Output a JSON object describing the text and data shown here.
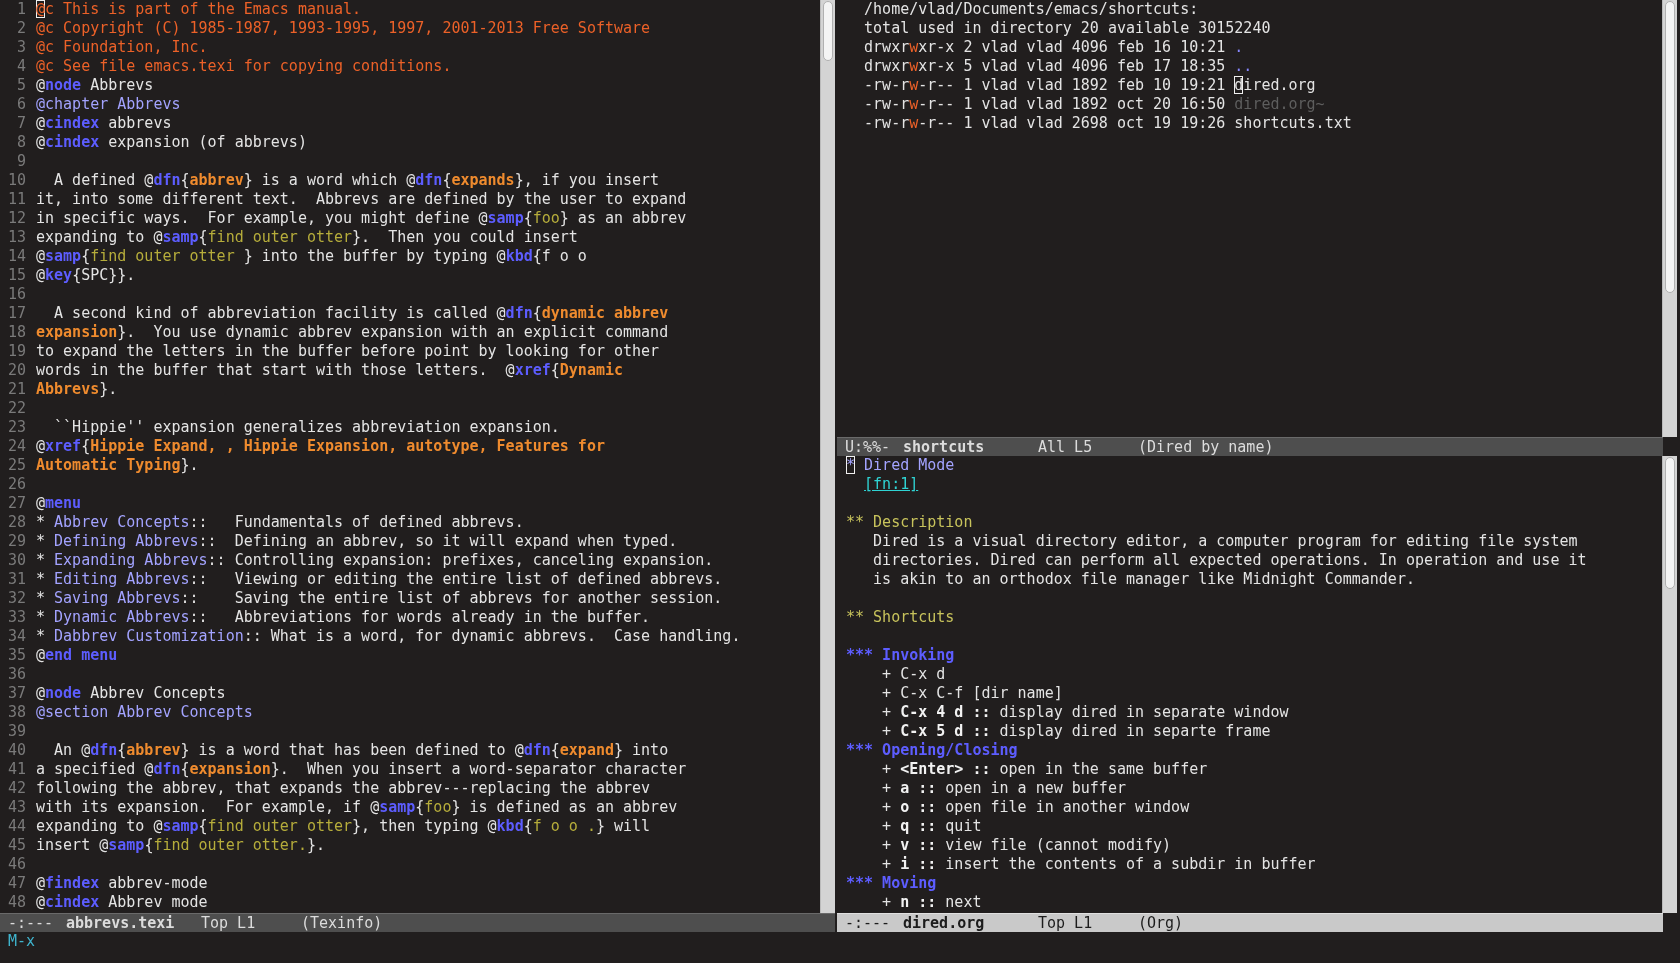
{
  "left_pane": {
    "lines": [
      {
        "number": "1",
        "segments": [
          {
            "text": "@",
            "kind": "comment",
            "cursor": true
          },
          {
            "text": "c This is part of the Emacs manual.",
            "kind": "comment"
          }
        ]
      },
      {
        "number": "2",
        "segments": [
          {
            "text": "@c Copyright (C) 1985-1987, 1993-1995, 1997, 2001-2013 Free Software",
            "kind": "comment"
          }
        ]
      },
      {
        "number": "3",
        "segments": [
          {
            "text": "@c Foundation, Inc.",
            "kind": "comment"
          }
        ]
      },
      {
        "number": "4",
        "segments": [
          {
            "text": "@c See file emacs.texi for copying conditions.",
            "kind": "comment"
          }
        ]
      },
      {
        "number": "5",
        "segments": [
          "@",
          {
            "text": "node",
            "kind": "command"
          },
          " Abbrevs"
        ]
      },
      {
        "number": "6",
        "segments": [
          {
            "text": "@chapter Abbrevs",
            "kind": "title"
          }
        ]
      },
      {
        "number": "7",
        "segments": [
          "@",
          {
            "text": "cindex",
            "kind": "command"
          },
          " abbrevs"
        ]
      },
      {
        "number": "8",
        "segments": [
          "@",
          {
            "text": "cindex",
            "kind": "command"
          },
          " expansion (of abbrevs)"
        ]
      },
      {
        "number": "9"
      },
      {
        "number": "10",
        "segments": [
          "  A defined @",
          {
            "text": "dfn",
            "kind": "command"
          },
          "{",
          {
            "text": "abbrev",
            "kind": "argument"
          },
          "} is a word which @",
          {
            "text": "dfn",
            "kind": "command"
          },
          "{",
          {
            "text": "expands",
            "kind": "argument"
          },
          "}, if you insert"
        ]
      },
      {
        "number": "11",
        "segments": [
          "it, into some different text.  Abbrevs are defined by the user to expand"
        ]
      },
      {
        "number": "12",
        "segments": [
          "in specific ways.  For example, you might define @",
          {
            "text": "samp",
            "kind": "command"
          },
          "{",
          {
            "text": "foo",
            "kind": "sample"
          },
          "} as an abbrev"
        ]
      },
      {
        "number": "13",
        "segments": [
          "expanding to @",
          {
            "text": "samp",
            "kind": "command"
          },
          "{",
          {
            "text": "find outer otter",
            "kind": "sample"
          },
          "}.  Then you could insert"
        ]
      },
      {
        "number": "14",
        "segments": [
          "@",
          {
            "text": "samp",
            "kind": "command"
          },
          "{",
          {
            "text": "find outer otter ",
            "kind": "sample"
          },
          "} into the buffer by typing @",
          {
            "text": "kbd",
            "kind": "command"
          },
          "{f o o"
        ]
      },
      {
        "number": "15",
        "segments": [
          "@",
          {
            "text": "key",
            "kind": "command"
          },
          "{SPC}}."
        ]
      },
      {
        "number": "16"
      },
      {
        "number": "17",
        "segments": [
          "  A second kind of abbreviation facility is called @",
          {
            "text": "dfn",
            "kind": "command"
          },
          "{",
          {
            "text": "dynamic abbrev",
            "kind": "argument"
          }
        ]
      },
      {
        "number": "18",
        "segments": [
          {
            "text": "expansion",
            "kind": "argument"
          },
          "}.  You use dynamic abbrev expansion with an explicit command"
        ]
      },
      {
        "number": "19",
        "segments": [
          "to expand the letters in the buffer before point by looking for other"
        ]
      },
      {
        "number": "20",
        "segments": [
          "words in the buffer that start with those letters.  @",
          {
            "text": "xref",
            "kind": "command"
          },
          "{",
          {
            "text": "Dynamic",
            "kind": "argument"
          }
        ]
      },
      {
        "number": "21",
        "segments": [
          {
            "text": "Abbrevs",
            "kind": "argument"
          },
          "}."
        ]
      },
      {
        "number": "22"
      },
      {
        "number": "23",
        "segments": [
          "  ``Hippie'' expansion generalizes abbreviation expansion."
        ]
      },
      {
        "number": "24",
        "segments": [
          "@",
          {
            "text": "xref",
            "kind": "command"
          },
          "{",
          {
            "text": "Hippie Expand, , Hippie Expansion, autotype, Features for",
            "kind": "argument"
          }
        ]
      },
      {
        "number": "25",
        "segments": [
          {
            "text": "Automatic Typing",
            "kind": "argument"
          },
          "}."
        ]
      },
      {
        "number": "26"
      },
      {
        "number": "27",
        "segments": [
          "@",
          {
            "text": "menu",
            "kind": "command"
          }
        ]
      },
      {
        "number": "28",
        "segments": [
          "* ",
          {
            "text": "Abbrev Concepts",
            "kind": "title"
          },
          "::   Fundamentals of defined abbrevs."
        ]
      },
      {
        "number": "29",
        "segments": [
          "* ",
          {
            "text": "Defining Abbrevs",
            "kind": "title"
          },
          "::  Defining an abbrev, so it will expand when typed."
        ]
      },
      {
        "number": "30",
        "segments": [
          "* ",
          {
            "text": "Expanding Abbrevs",
            "kind": "title"
          },
          ":: Controlling expansion: prefixes, canceling expansion."
        ]
      },
      {
        "number": "31",
        "segments": [
          "* ",
          {
            "text": "Editing Abbrevs",
            "kind": "title"
          },
          "::   Viewing or editing the entire list of defined abbrevs."
        ]
      },
      {
        "number": "32",
        "segments": [
          "* ",
          {
            "text": "Saving Abbrevs",
            "kind": "title"
          },
          "::    Saving the entire list of abbrevs for another session."
        ]
      },
      {
        "number": "33",
        "segments": [
          "* ",
          {
            "text": "Dynamic Abbrevs",
            "kind": "title"
          },
          "::   Abbreviations for words already in the buffer."
        ]
      },
      {
        "number": "34",
        "segments": [
          "* ",
          {
            "text": "Dabbrev Customization",
            "kind": "title"
          },
          ":: What is a word, for dynamic abbrevs.  Case handling."
        ]
      },
      {
        "number": "35",
        "segments": [
          "@",
          {
            "text": "end menu",
            "kind": "command"
          }
        ]
      },
      {
        "number": "36"
      },
      {
        "number": "37",
        "segments": [
          "@",
          {
            "text": "node",
            "kind": "command"
          },
          " Abbrev Concepts"
        ]
      },
      {
        "number": "38",
        "segments": [
          {
            "text": "@section Abbrev Concepts",
            "kind": "title"
          }
        ]
      },
      {
        "number": "39"
      },
      {
        "number": "40",
        "segments": [
          "  An @",
          {
            "text": "dfn",
            "kind": "command"
          },
          "{",
          {
            "text": "abbrev",
            "kind": "argument"
          },
          "} is a word that has been defined to @",
          {
            "text": "dfn",
            "kind": "command"
          },
          "{",
          {
            "text": "expand",
            "kind": "argument"
          },
          "} into"
        ]
      },
      {
        "number": "41",
        "segments": [
          "a specified @",
          {
            "text": "dfn",
            "kind": "command"
          },
          "{",
          {
            "text": "expansion",
            "kind": "argument"
          },
          "}.  When you insert a word-separator character"
        ]
      },
      {
        "number": "42",
        "segments": [
          "following the abbrev, that expands the abbrev---replacing the abbrev"
        ]
      },
      {
        "number": "43",
        "segments": [
          "with its expansion.  For example, if @",
          {
            "text": "samp",
            "kind": "command"
          },
          "{",
          {
            "text": "foo",
            "kind": "sample"
          },
          "} is defined as an abbrev"
        ]
      },
      {
        "number": "44",
        "segments": [
          "expanding to @",
          {
            "text": "samp",
            "kind": "command"
          },
          "{",
          {
            "text": "find outer otter",
            "kind": "sample"
          },
          "}, then typing @",
          {
            "text": "kbd",
            "kind": "command"
          },
          "{",
          {
            "text": "f o o .",
            "kind": "sample"
          },
          "} will"
        ]
      },
      {
        "number": "45",
        "segments": [
          "insert @",
          {
            "text": "samp",
            "kind": "command"
          },
          "{",
          {
            "text": "find outer otter.",
            "kind": "sample"
          },
          "}."
        ]
      },
      {
        "number": "46"
      },
      {
        "number": "47",
        "segments": [
          "@",
          {
            "text": "findex",
            "kind": "command"
          },
          " abbrev-mode"
        ]
      },
      {
        "number": "48",
        "segments": [
          "@",
          {
            "text": "cindex",
            "kind": "command"
          },
          " Abbrev mode"
        ]
      }
    ],
    "mode_line": {
      "status": "-:---",
      "buffer": "abbrevs.texi",
      "position": "Top L1",
      "mode": "(Texinfo)",
      "active": false
    }
  },
  "right_top_pane": {
    "lines": [
      {
        "segments": [
          "  /home/vlad/Documents/emacs/shortcuts:"
        ]
      },
      {
        "segments": [
          "  total used in directory 20 available 30152240"
        ]
      },
      {
        "segments": [
          "  drwxr",
          {
            "text": "w",
            "kind": "write_flag"
          },
          "xr-x 2 vlad vlad 4096 feb 16 10:21 ",
          {
            "text": ".",
            "kind": "directory"
          }
        ]
      },
      {
        "segments": [
          "  drwxr",
          {
            "text": "w",
            "kind": "write_flag"
          },
          "xr-x 5 vlad vlad 4096 feb 17 18:35 ",
          {
            "text": "..",
            "kind": "directory"
          }
        ]
      },
      {
        "segments": [
          "  -rw-r",
          {
            "text": "w",
            "kind": "write_flag"
          },
          "-r-- 1 vlad vlad 1892 feb 10 19:21 ",
          {
            "text": "d",
            "kind": "plain",
            "cursor": true
          },
          "ired.org"
        ]
      },
      {
        "segments": [
          "  -rw-r",
          {
            "text": "w",
            "kind": "write_flag"
          },
          "-r-- 1 vlad vlad 1892 oct 20 16:50 ",
          {
            "text": "dired.org~",
            "kind": "backup"
          }
        ]
      },
      {
        "segments": [
          "  -rw-r",
          {
            "text": "w",
            "kind": "write_flag"
          },
          "-r-- 1 vlad vlad 2698 oct 19 19:26 shortcuts.txt"
        ]
      }
    ],
    "mode_line": {
      "status": "U:%%-",
      "buffer": "shortcuts",
      "position": "All L5",
      "mode": "(Dired by name)",
      "active": false
    }
  },
  "right_bottom_pane": {
    "blocks": [
      {
        "lines": [
          {
            "segments": [
              {
                "text": "*",
                "kind": "heading_1",
                "cursor": true
              },
              {
                "text": " Dired Mode",
                "kind": "heading_1"
              }
            ]
          },
          {
            "segments": [
              {
                "text": "[fn:1]",
                "kind": "link"
              }
            ]
          }
        ]
      },
      {
        "lines": [
          {
            "segments": [
              {
                "text": "** Description",
                "kind": "heading_2"
              }
            ]
          },
          {
            "segments": [
              "   Dired is a visual directory editor, a computer program for editing file system"
            ]
          },
          {
            "segments": [
              "   directories. Dired can perform all expected operations. In operation and use it"
            ]
          },
          {
            "segments": [
              "   is akin to an orthodox file manager like Midnight Commander."
            ]
          }
        ]
      },
      {
        "lines": [
          {
            "segments": [
              {
                "text": "** Shortcuts",
                "kind": "heading_2"
              }
            ]
          }
        ]
      },
      {
        "lines": [
          {
            "segments": [
              {
                "text": "*** Invoking",
                "kind": "heading_3"
              }
            ]
          },
          {
            "segments": [
              "    + C-x d"
            ]
          },
          {
            "segments": [
              "    + C-x C-f [dir name]"
            ]
          },
          {
            "segments": [
              "    + ",
              {
                "text": "C-x 4 d ::",
                "kind": "bold"
              },
              " display dired in separate window"
            ]
          },
          {
            "segments": [
              "    + ",
              {
                "text": "C-x 5 d ::",
                "kind": "bold"
              },
              " display dired in separte frame"
            ]
          },
          {
            "segments": [
              {
                "text": "*** Opening/Closing",
                "kind": "heading_3"
              }
            ]
          },
          {
            "segments": [
              "    + ",
              {
                "text": "<Enter> ::",
                "kind": "bold"
              },
              " open in the same buffer"
            ]
          },
          {
            "segments": [
              "    + ",
              {
                "text": "a ::",
                "kind": "bold"
              },
              " open in a new buffer"
            ]
          },
          {
            "segments": [
              "    + ",
              {
                "text": "o ::",
                "kind": "bold"
              },
              " open file in another window"
            ]
          },
          {
            "segments": [
              "    + ",
              {
                "text": "q ::",
                "kind": "bold"
              },
              " quit"
            ]
          },
          {
            "segments": [
              "    + ",
              {
                "text": "v ::",
                "kind": "bold"
              },
              " view file (cannot modify)"
            ]
          },
          {
            "segments": [
              "    + ",
              {
                "text": "i ::",
                "kind": "bold"
              },
              " insert the contents of a subdir in buffer"
            ]
          },
          {
            "segments": [
              {
                "text": "*** Moving",
                "kind": "heading_3"
              }
            ]
          },
          {
            "segments": [
              "    + ",
              {
                "text": "n ::",
                "kind": "bold"
              },
              " next"
            ]
          }
        ]
      }
    ],
    "mode_line": {
      "status": "-:---",
      "buffer": "dired.org",
      "position": "Top L1",
      "mode": "(Org)",
      "active": true
    }
  },
  "minibuffer": {
    "prompt": "M-x"
  }
}
